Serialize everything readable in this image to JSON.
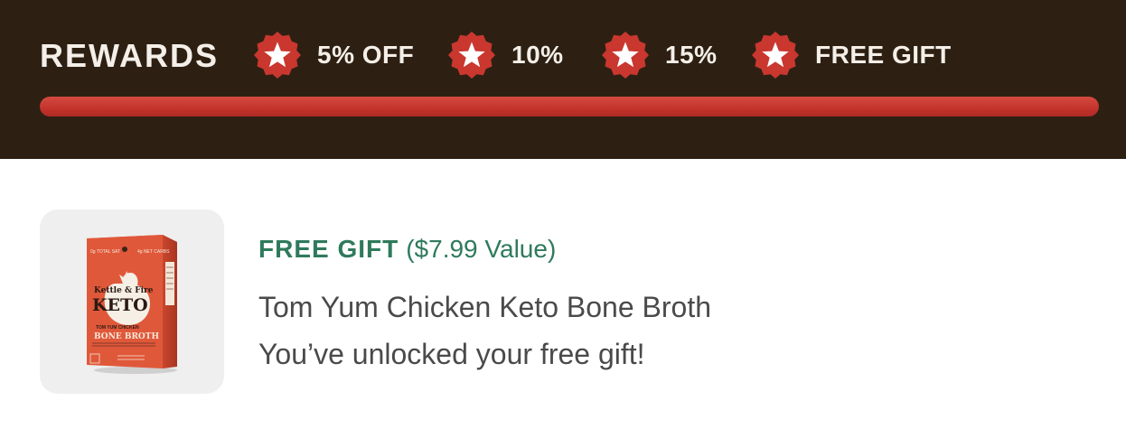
{
  "rewards": {
    "title": "REWARDS",
    "progress_percent": 100,
    "colors": {
      "background": "#2d2013",
      "accent": "#c9372f",
      "text": "#f4efe8"
    },
    "tiers": [
      {
        "label": "5% OFF",
        "icon": "star-badge-icon"
      },
      {
        "label": "10%",
        "icon": "star-badge-icon"
      },
      {
        "label": "15%",
        "icon": "star-badge-icon"
      },
      {
        "label": "FREE GIFT",
        "icon": "star-badge-icon"
      }
    ]
  },
  "gift": {
    "tag": "FREE GIFT",
    "value": "($7.99 Value)",
    "product_name": "Tom Yum Chicken Keto Bone Broth",
    "message": "You’ve unlocked your free gift!",
    "image_icon": "product-box-image",
    "colors": {
      "tag": "#2f7a5c",
      "text": "#4a4a4a",
      "card": "#efefef"
    },
    "packaging": {
      "badge_left": "0g TOTAL SAT",
      "badge_right": "4g NET CARBS",
      "brand": "Kettle & Fire",
      "product_line": "KETO",
      "flavor": "TOM YUM CHICKEN",
      "product_type": "BONE BROTH"
    }
  }
}
